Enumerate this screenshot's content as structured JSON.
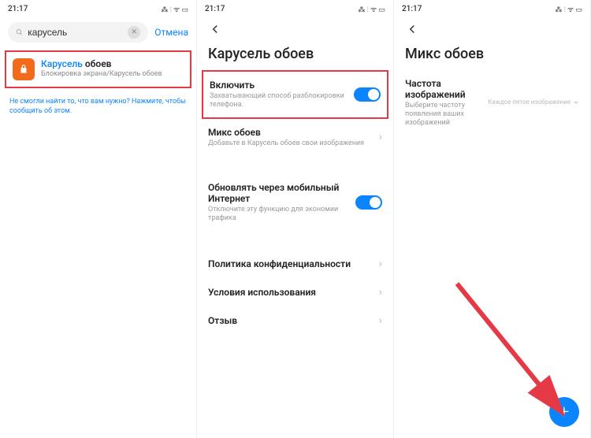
{
  "status": {
    "time": "21:17",
    "icons": "⁂ ⫶ ᯤ ▭"
  },
  "pane1": {
    "search": {
      "value": "карусель",
      "cancel": "Отмена"
    },
    "result": {
      "title_blue": "Карусель",
      "title_black": "обоев",
      "subtitle": "Блокировка экрана/Карусель обоев"
    },
    "hint": "Не смогли найти то, что вам нужно? Нажмите, чтобы сообщить об этом."
  },
  "pane2": {
    "title": "Карусель обоев",
    "items": [
      {
        "title": "Включить",
        "sub": "Захватывающий способ разблокировки телефона."
      },
      {
        "title": "Микс обоев",
        "sub": "Добавьте в Карусель обоев свои изображения"
      },
      {
        "title": "Обновлять через мобильный Интернет",
        "sub": "Отключите эту функцию для экономии трафика"
      },
      {
        "title": "Политика конфиденциальности"
      },
      {
        "title": "Условия использования"
      },
      {
        "title": "Отзыв"
      }
    ]
  },
  "pane3": {
    "title": "Микс обоев",
    "freq": {
      "title": "Частота изображений",
      "sub": "Выберите частоту появления ваших изображений",
      "value": "Каждое пятое изображение"
    }
  }
}
